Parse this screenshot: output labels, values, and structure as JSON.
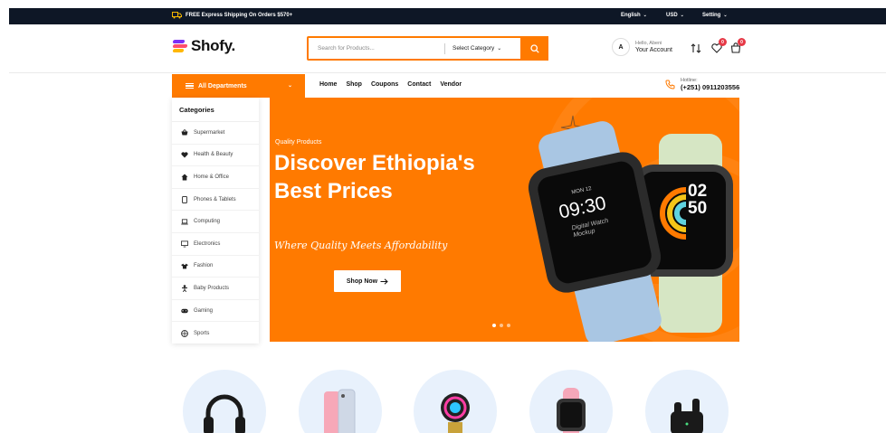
{
  "topbar": {
    "shipping_text": "FREE Express Shipping On Orders $570+",
    "language": "English",
    "currency": "USD",
    "setting": "Setting"
  },
  "header": {
    "logo_text": "Shofy.",
    "search_placeholder": "Search for Products...",
    "category_select": "Select Category",
    "greeting": "Hello, Abeni",
    "account_label": "Your Account",
    "avatar_letter": "A",
    "wishlist_count": "0",
    "cart_count": "0"
  },
  "nav": {
    "departments_label": "All Departments",
    "links": [
      "Home",
      "Shop",
      "Coupons",
      "Contact",
      "Vendor"
    ],
    "hotline_label": "Hotline:",
    "hotline_number": "(+251) 0911203556"
  },
  "sidebar": {
    "title": "Categories",
    "categories": [
      {
        "label": "Supermarket",
        "icon": "basket-icon"
      },
      {
        "label": "Health & Beauty",
        "icon": "heart-icon"
      },
      {
        "label": "Home & Office",
        "icon": "home-icon"
      },
      {
        "label": "Phones & Tablets",
        "icon": "phone-icon"
      },
      {
        "label": "Computing",
        "icon": "laptop-icon"
      },
      {
        "label": "Electronics",
        "icon": "monitor-icon"
      },
      {
        "label": "Fashion",
        "icon": "shirt-icon"
      },
      {
        "label": "Baby Products",
        "icon": "baby-icon"
      },
      {
        "label": "Gaming",
        "icon": "gamepad-icon"
      },
      {
        "label": "Sports",
        "icon": "ball-icon"
      }
    ]
  },
  "hero": {
    "eyebrow": "Quality Products",
    "heading": "Discover Ethiopia's Best Prices",
    "tagline": "Where Quality Meets Affordability",
    "cta_label": "Shop Now",
    "watch_left": {
      "date": "MON 12",
      "time": "09:30",
      "caption": "Digital Watch Mockup"
    },
    "watch_right": {
      "hour": "02",
      "minute": "50"
    },
    "slides": 3,
    "active_slide": 1
  },
  "category_circles": [
    "headphones-icon",
    "smartphone-icon",
    "cpu-cooler-icon",
    "smartwatch-icon",
    "earbuds-icon"
  ],
  "colors": {
    "accent": "#ff7a00",
    "topbar_bg": "#0e1726",
    "badge": "#e63946",
    "circle_bg": "#e8f1fc"
  }
}
